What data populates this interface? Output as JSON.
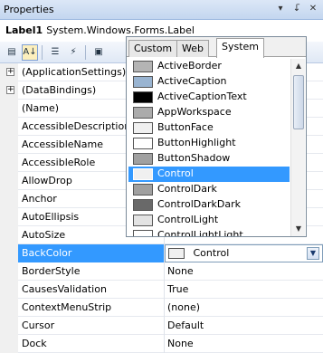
{
  "window": {
    "title": "Properties",
    "pin_glyph": "↓̄",
    "close_glyph": "✕"
  },
  "object_selector": {
    "name": "Label1",
    "type": "System.Windows.Forms.Label"
  },
  "toolbar": {
    "categorized_icon": "categorized-icon",
    "alphabetical_icon": "alphabetical-icon",
    "properties_icon": "properties-icon",
    "events_icon": "events-icon",
    "property_pages_icon": "property-pages-icon"
  },
  "properties": [
    {
      "name": "(ApplicationSettings)",
      "value": "",
      "expandable": true
    },
    {
      "name": "(DataBindings)",
      "value": "",
      "expandable": true
    },
    {
      "name": "(Name)",
      "value": ""
    },
    {
      "name": "AccessibleDescription",
      "value": ""
    },
    {
      "name": "AccessibleName",
      "value": ""
    },
    {
      "name": "AccessibleRole",
      "value": ""
    },
    {
      "name": "AllowDrop",
      "value": ""
    },
    {
      "name": "Anchor",
      "value": ""
    },
    {
      "name": "AutoEllipsis",
      "value": ""
    },
    {
      "name": "AutoSize",
      "value": ""
    },
    {
      "name": "BackColor",
      "value": "Control",
      "selected": true,
      "swatch": "#f0f0f0"
    },
    {
      "name": "BorderStyle",
      "value": "None"
    },
    {
      "name": "CausesValidation",
      "value": "True"
    },
    {
      "name": "ContextMenuStrip",
      "value": "(none)"
    },
    {
      "name": "Cursor",
      "value": "Default"
    },
    {
      "name": "Dock",
      "value": "None"
    }
  ],
  "color_picker": {
    "tabs": [
      {
        "label": "Custom",
        "active": false
      },
      {
        "label": "Web",
        "active": false
      },
      {
        "label": "System",
        "active": true
      }
    ],
    "colors": [
      {
        "name": "ActiveBorder",
        "color": "#b4b4b4"
      },
      {
        "name": "ActiveCaption",
        "color": "#99b4d1"
      },
      {
        "name": "ActiveCaptionText",
        "color": "#000000"
      },
      {
        "name": "AppWorkspace",
        "color": "#ababab"
      },
      {
        "name": "ButtonFace",
        "color": "#f0f0f0"
      },
      {
        "name": "ButtonHighlight",
        "color": "#ffffff"
      },
      {
        "name": "ButtonShadow",
        "color": "#a0a0a0"
      },
      {
        "name": "Control",
        "color": "#f0f0f0",
        "selected": true
      },
      {
        "name": "ControlDark",
        "color": "#a0a0a0"
      },
      {
        "name": "ControlDarkDark",
        "color": "#696969"
      },
      {
        "name": "ControlLight",
        "color": "#e3e3e3"
      },
      {
        "name": "ControlLightLight",
        "color": "#ffffff"
      }
    ]
  },
  "colors": {
    "selection": "#3399ff",
    "titlebar": "#c3d6ef"
  }
}
